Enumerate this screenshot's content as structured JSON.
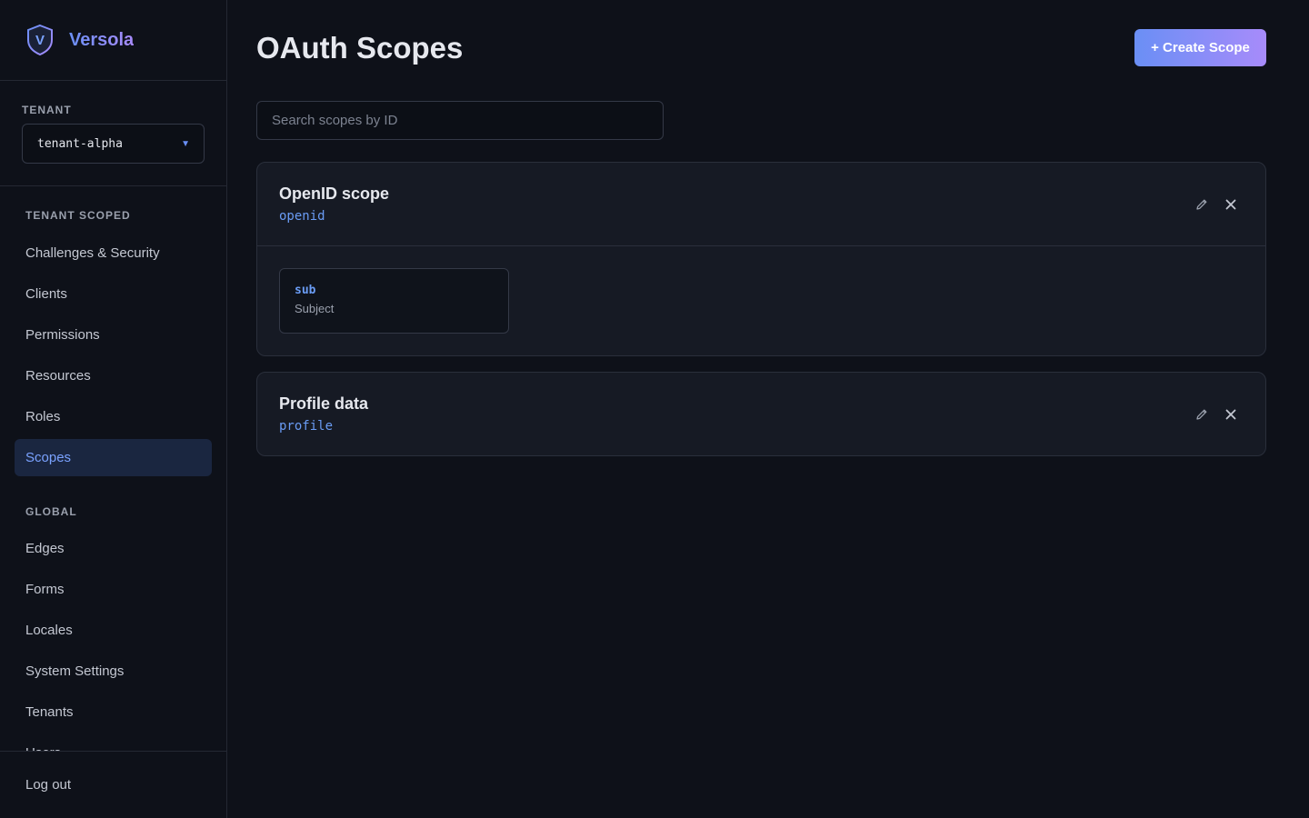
{
  "brand": {
    "name": "Versola",
    "logo_letter": "V"
  },
  "tenant": {
    "label": "TENANT",
    "value": "tenant-alpha",
    "caret_icon": "caret-down-icon"
  },
  "nav": {
    "tenant_scoped_label": "TENANT SCOPED",
    "tenant_scoped": [
      {
        "label": "Challenges & Security"
      },
      {
        "label": "Clients"
      },
      {
        "label": "Permissions"
      },
      {
        "label": "Resources"
      },
      {
        "label": "Roles"
      },
      {
        "label": "Scopes",
        "active": true
      }
    ],
    "global_label": "GLOBAL",
    "global": [
      {
        "label": "Edges"
      },
      {
        "label": "Forms"
      },
      {
        "label": "Locales"
      },
      {
        "label": "System Settings"
      },
      {
        "label": "Tenants"
      },
      {
        "label": "Users"
      }
    ],
    "logout": "Log out"
  },
  "main": {
    "title": "OAuth Scopes",
    "create_button": "+ Create Scope",
    "search_placeholder": "Search scopes by ID",
    "scopes": [
      {
        "name": "OpenID scope",
        "id": "openid",
        "claims": [
          {
            "key": "sub",
            "description": "Subject"
          }
        ]
      },
      {
        "name": "Profile data",
        "id": "profile",
        "claims": []
      }
    ]
  },
  "colors": {
    "background": "#0e1119",
    "accent_start": "#6a8ff5",
    "accent_end": "#a78bfa",
    "active_nav_bg": "#1a2640",
    "mono_text": "#6a9cf5"
  }
}
